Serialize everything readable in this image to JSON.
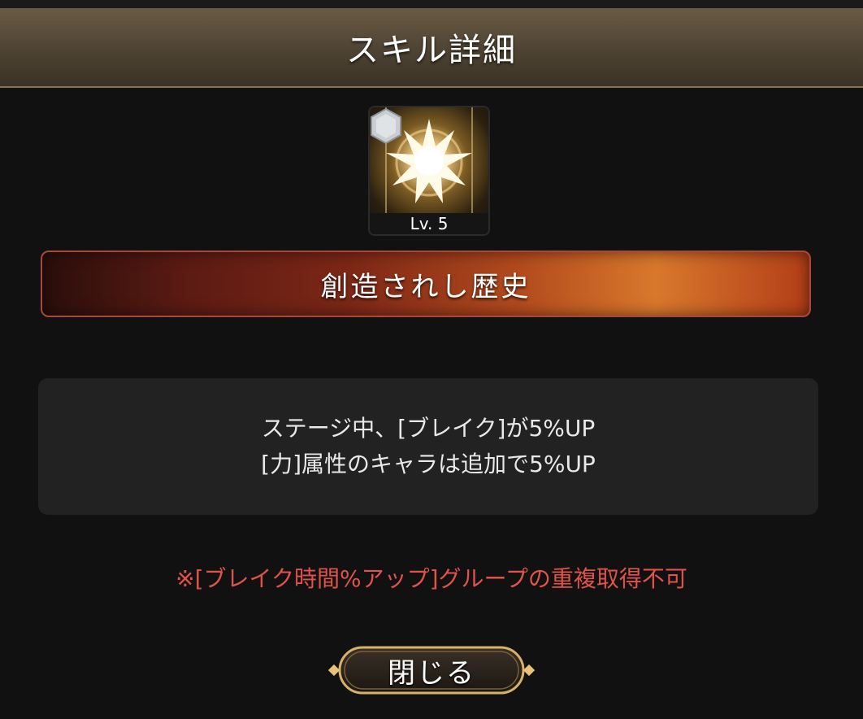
{
  "header": {
    "title": "スキル詳細"
  },
  "skill": {
    "icon": "burst-star-icon",
    "rank_badge_icon": "silver-hexagon-badge",
    "level": "Lv. 5",
    "name": "創造されし歴史"
  },
  "description": {
    "lines": [
      "ステージ中、[ブレイク]が5%UP",
      "[力]属性のキャラは追加で5%UP"
    ]
  },
  "note": "※[ブレイク時間%アップ]グループの重複取得不可",
  "buttons": {
    "close_label": "閉じる"
  },
  "colors": {
    "header_bg": "#5a4c3a",
    "banner_start": "#2a0e0b",
    "banner_end": "#d8782c",
    "note_text": "#e0524a",
    "desc_box_bg": "#222222"
  }
}
